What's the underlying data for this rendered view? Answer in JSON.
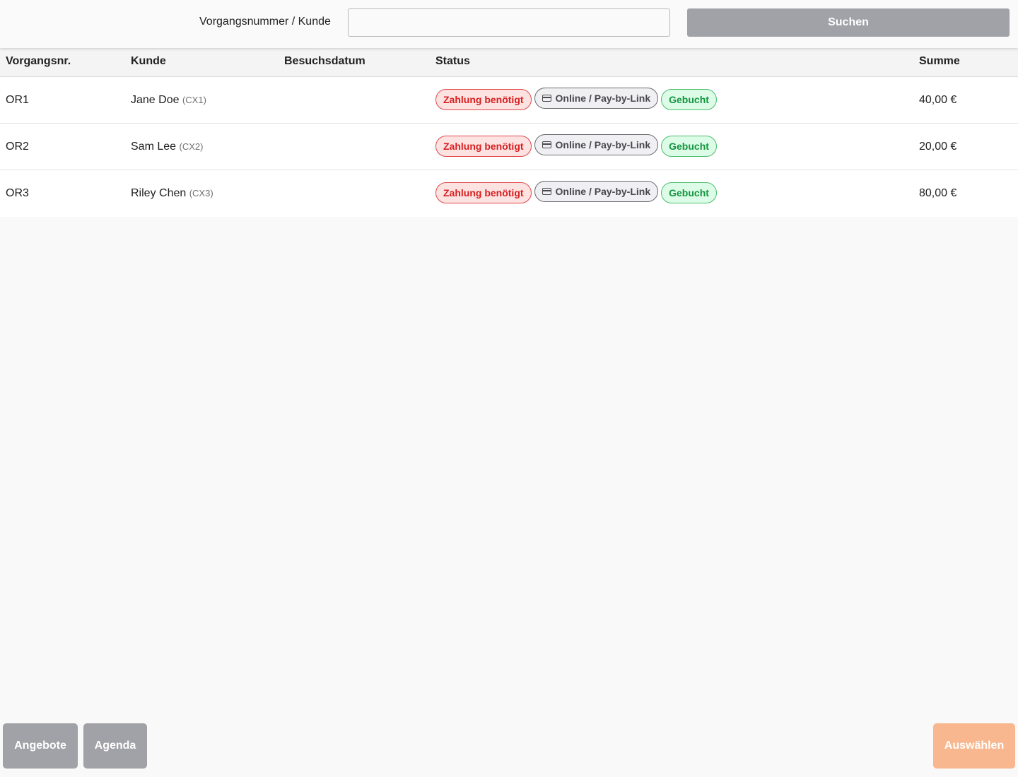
{
  "search": {
    "label": "Vorgangsnummer / Kunde",
    "value": "",
    "placeholder": "",
    "button_label": "Suchen"
  },
  "table": {
    "headers": {
      "number": "Vorgangsnr.",
      "customer": "Kunde",
      "visit_date": "Besuchsdatum",
      "status": "Status",
      "total": "Summe"
    },
    "rows": [
      {
        "number": "OR1",
        "customer_name": "Jane Doe",
        "customer_id": "(CX1)",
        "visit_date": "",
        "status_payment": "Zahlung benötigt",
        "status_method": "Online / Pay-by-Link",
        "status_booking": "Gebucht",
        "total": "40,00 €"
      },
      {
        "number": "OR2",
        "customer_name": "Sam Lee",
        "customer_id": "(CX2)",
        "visit_date": "",
        "status_payment": "Zahlung benötigt",
        "status_method": "Online / Pay-by-Link",
        "status_booking": "Gebucht",
        "total": "20,00 €"
      },
      {
        "number": "OR3",
        "customer_name": "Riley Chen",
        "customer_id": "(CX3)",
        "visit_date": "",
        "status_payment": "Zahlung benötigt",
        "status_method": "Online / Pay-by-Link",
        "status_booking": "Gebucht",
        "total": "80,00 €"
      }
    ]
  },
  "footer": {
    "offers_label": "Angebote",
    "agenda_label": "Agenda",
    "select_label": "Auswählen"
  },
  "icons": {
    "payment_method": "credit-card-icon"
  },
  "colors": {
    "button_gray": "#a1a1a8",
    "select_orange": "#f8b78e",
    "payment_red": "#d72020",
    "booked_green": "#14953e"
  }
}
